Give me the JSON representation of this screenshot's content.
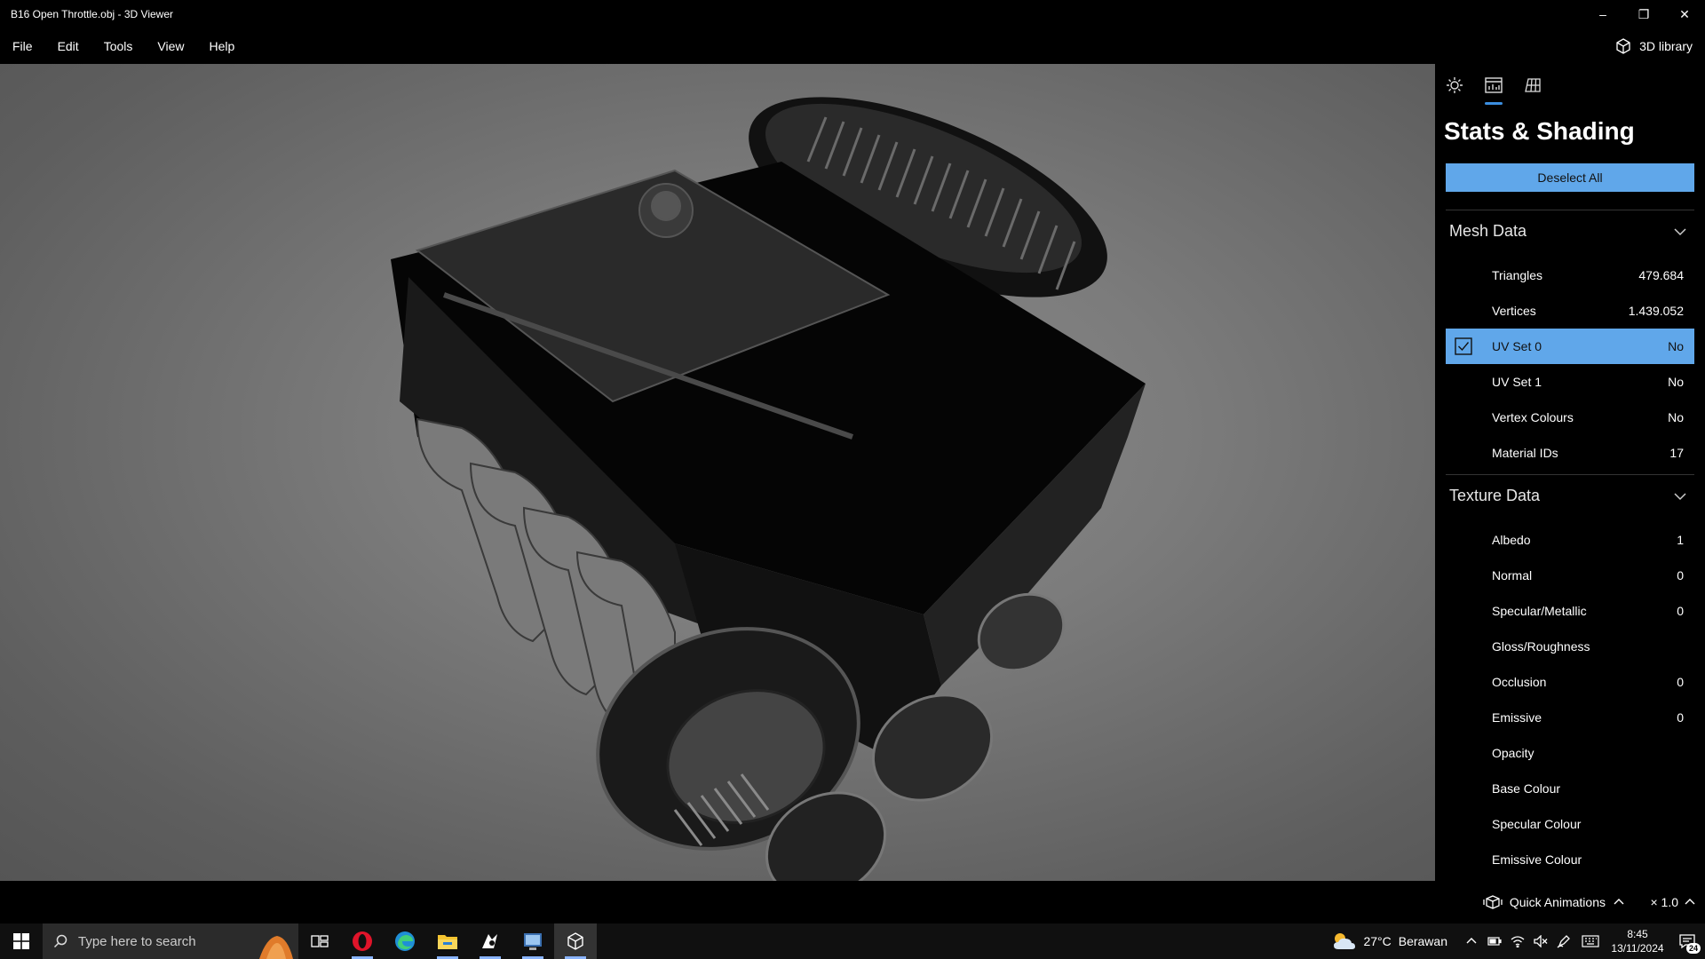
{
  "window": {
    "title": "B16 Open Throttle.obj - 3D Viewer",
    "controls": {
      "minimize": "–",
      "restore": "❐",
      "close": "✕"
    }
  },
  "menu": {
    "items": [
      "File",
      "Edit",
      "Tools",
      "View",
      "Help"
    ],
    "library_label": "3D library"
  },
  "panel": {
    "tabs": [
      {
        "icon": "sun-icon",
        "active": false
      },
      {
        "icon": "stats-icon",
        "active": true
      },
      {
        "icon": "grid-icon",
        "active": false
      }
    ],
    "title": "Stats & Shading",
    "deselect_label": "Deselect All",
    "mesh_section": {
      "label": "Mesh Data",
      "rows": [
        {
          "label": "Triangles",
          "value": "479.684"
        },
        {
          "label": "Vertices",
          "value": "1.439.052"
        },
        {
          "label": "UV Set 0",
          "value": "No",
          "selected": true,
          "checked": true
        },
        {
          "label": "UV Set 1",
          "value": "No"
        },
        {
          "label": "Vertex Colours",
          "value": "No"
        },
        {
          "label": "Material IDs",
          "value": "17"
        }
      ]
    },
    "texture_section": {
      "label": "Texture Data",
      "rows": [
        {
          "label": "Albedo",
          "value": "1"
        },
        {
          "label": "Normal",
          "value": "0"
        },
        {
          "label": "Specular/Metallic",
          "value": "0"
        },
        {
          "label": "Gloss/Roughness",
          "value": ""
        },
        {
          "label": "Occlusion",
          "value": "0"
        },
        {
          "label": "Emissive",
          "value": "0"
        },
        {
          "label": "Opacity",
          "value": ""
        },
        {
          "label": "Base Colour",
          "value": ""
        },
        {
          "label": "Specular Colour",
          "value": ""
        },
        {
          "label": "Emissive Colour",
          "value": ""
        }
      ]
    }
  },
  "bottom": {
    "quick_animations_label": "Quick Animations",
    "speed_label": "× 1.0"
  },
  "taskbar": {
    "search_placeholder": "Type here to search",
    "weather_temp": "27°C",
    "weather_text": "Berawan",
    "time": "8:45",
    "date": "13/11/2024",
    "notification_count": "24"
  },
  "colors": {
    "accent": "#60a7ea",
    "tab_underline": "#3b8ee0",
    "background": "#000000",
    "viewport": "#7c7c7c"
  }
}
